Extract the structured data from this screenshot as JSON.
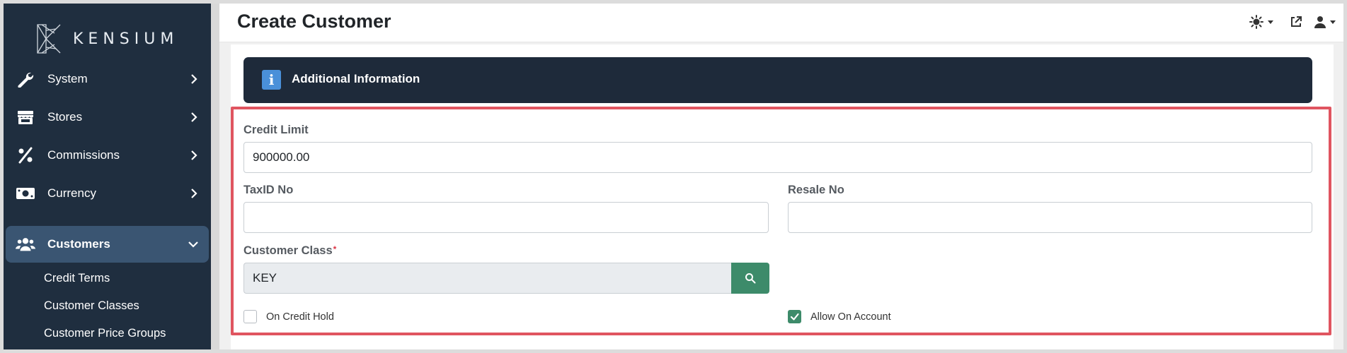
{
  "brand": {
    "name": "KENSIUM"
  },
  "sidebar": {
    "items": [
      {
        "label": "System",
        "icon": "wrench-icon"
      },
      {
        "label": "Stores",
        "icon": "store-icon"
      },
      {
        "label": "Commissions",
        "icon": "percent-icon"
      },
      {
        "label": "Currency",
        "icon": "money-bill-icon"
      },
      {
        "label": "Customers",
        "icon": "users-icon",
        "active": true
      }
    ],
    "subitems": [
      {
        "label": "Credit Terms"
      },
      {
        "label": "Customer Classes"
      },
      {
        "label": "Customer Price Groups"
      }
    ]
  },
  "header": {
    "title": "Create Customer"
  },
  "section": {
    "title": "Additional Information"
  },
  "form": {
    "credit_limit": {
      "label": "Credit Limit",
      "value": "900000.00"
    },
    "tax_id": {
      "label": "TaxID No",
      "value": ""
    },
    "resale_no": {
      "label": "Resale No",
      "value": ""
    },
    "customer_class": {
      "label": "Customer Class",
      "required_mark": "*",
      "value": "KEY"
    },
    "on_credit_hold": {
      "label": "On Credit Hold",
      "checked": false
    },
    "allow_on_account": {
      "label": "Allow On Account",
      "checked": true
    }
  },
  "colors": {
    "sidebar_bg": "#1f2e3f",
    "sidebar_active": "#3a5572",
    "banner_bg": "#1e2a3a",
    "accent_green": "#3d8b6a",
    "highlight_red": "#e05560",
    "info_blue": "#4a90d9"
  }
}
